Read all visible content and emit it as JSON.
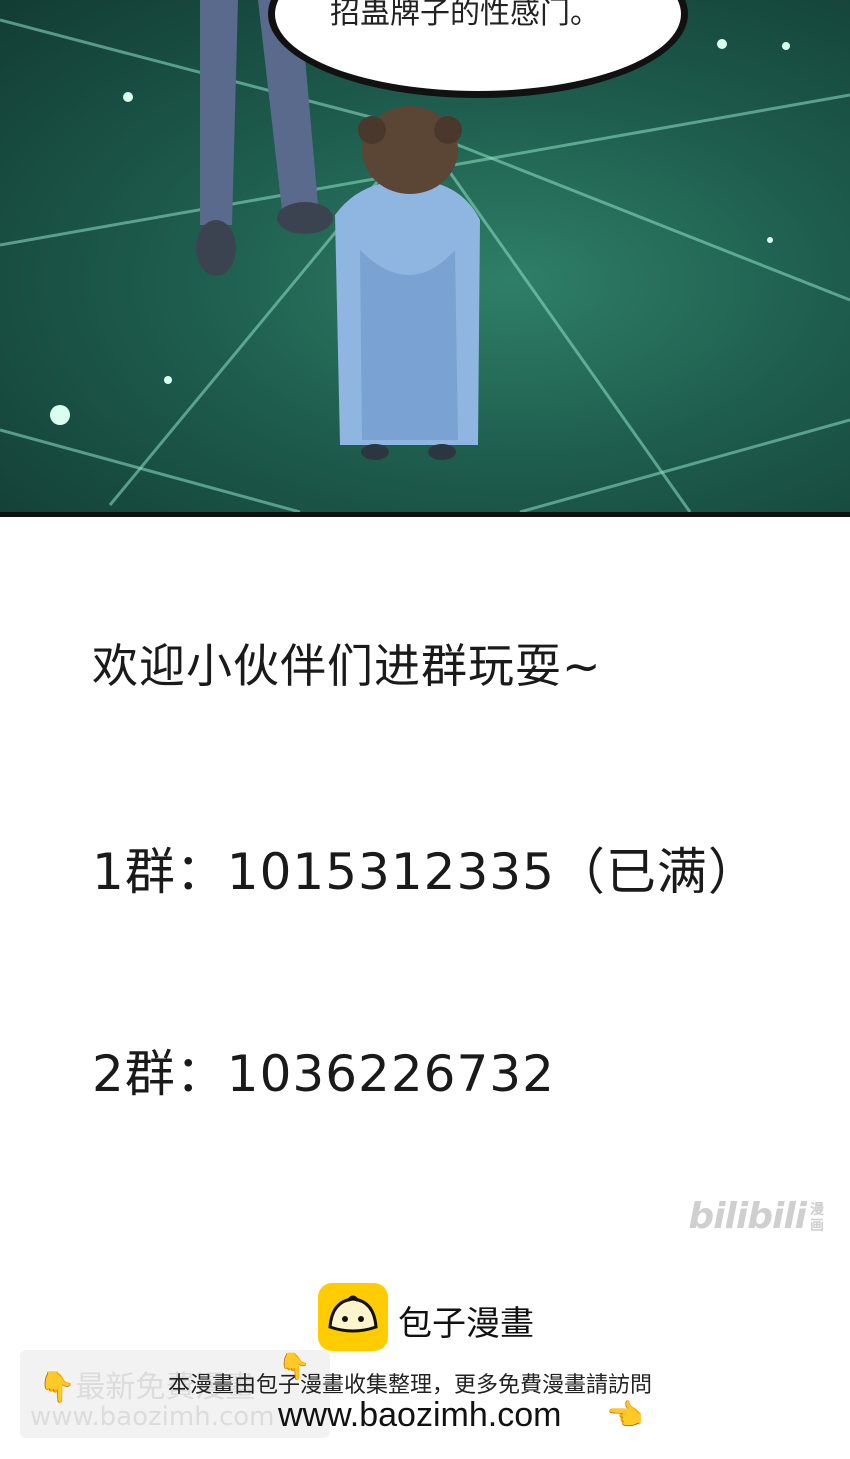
{
  "panel": {
    "speech_bubble_text": "招蛊牌子的性感门。"
  },
  "announcement": {
    "welcome": "欢迎小伙伴们进群玩耍~",
    "group1": "1群：1015312335（已满）",
    "group2": "2群：1036226732"
  },
  "watermark": {
    "bilibili_text": "bilibili",
    "bilibili_sub": "漫画"
  },
  "footer": {
    "site_name": "包子漫畫",
    "notice": "本漫畫由包子漫畫收集整理，更多免費漫畫請訪問",
    "url": "www.baozimh.com",
    "ghost_line1": "最新免費漫畫",
    "ghost_line2": "www.baozimh.com",
    "hand_icon": "pointing-hand-icon",
    "brand_color": "#ffcc00"
  }
}
